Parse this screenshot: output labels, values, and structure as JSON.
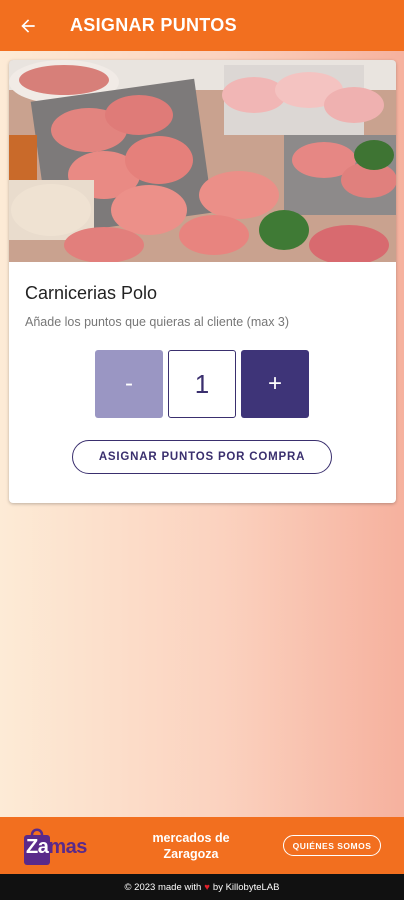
{
  "header": {
    "title": "ASIGNAR PUNTOS",
    "back_icon": "arrow-left-icon"
  },
  "card": {
    "shop_name": "Carnicerias Polo",
    "hint": "Añade los puntos que quieras al cliente (max 3)",
    "minus_label": "-",
    "quantity": "1",
    "plus_label": "+",
    "assign_button": "ASIGNAR PUNTOS POR COMPRA"
  },
  "footer": {
    "logo_za": "Za",
    "logo_mas": "mas",
    "tagline_line1": "mercados de",
    "tagline_line2": "Zaragoza",
    "about_button": "QUIÉNES SOMOS",
    "made_prefix": "© 2023 made with",
    "made_suffix": "by KillobyteLAB"
  },
  "colors": {
    "accent": "#f26f1f",
    "primary": "#3e3478",
    "muted": "#9a96c3"
  }
}
